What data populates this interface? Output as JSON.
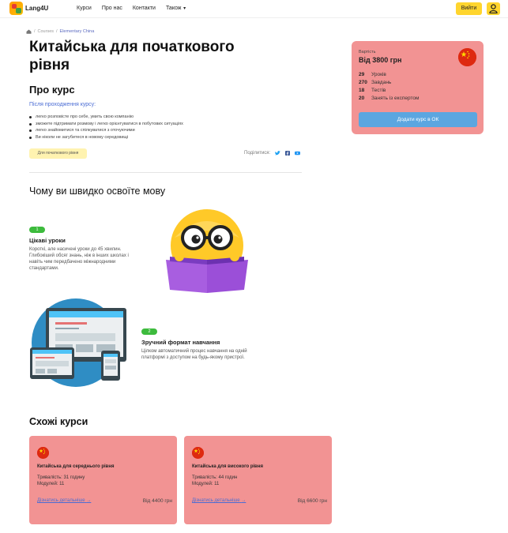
{
  "header": {
    "logo_text": "Lang4U",
    "nav": [
      "Курси",
      "Про нас",
      "Контакти",
      "Також"
    ],
    "login_label": "Вийти"
  },
  "breadcrumb": [
    "Courses",
    "Elementary China"
  ],
  "page": {
    "title": "Китайська для початкового рівня",
    "about_title": "Про курс",
    "after_label": "Після проходження курсу:",
    "benefits": [
      "легко розповісте про себе, умить свою компанію",
      "зможете підтримати розмову і легко орієнтуватися в побутових ситуаціях",
      "легко знайомитися та спілкуватися з оточуючими",
      "Ви ніколи не загубитеся в новому середовищі"
    ],
    "level_badge": "Для початкового рівня",
    "share_label": "Поділитися:"
  },
  "price_card": {
    "label": "Вартість",
    "value": "Від 3800 грн",
    "stats": [
      {
        "num": "29",
        "text": "Уроків"
      },
      {
        "num": "270",
        "text": "Завдань"
      },
      {
        "num": "18",
        "text": "Тестів"
      },
      {
        "num": "20",
        "text": "Занять із експертом"
      }
    ],
    "add_button": "Додати курс в ОК"
  },
  "why": {
    "title": "Чому ви швидко освоїте мову",
    "features": [
      {
        "num": "1",
        "title": "Цікаві уроки",
        "desc": "Короткі, але насичені уроки до 45 хвилин. Глибокіший обсяг знань, ніж в інших школах і навіть чим передбачено міжнародними стандартами."
      },
      {
        "num": "2",
        "title": "Зручний формат навчання",
        "desc": "Цілком автоматичний процес навчання на одній платформі з доступом на будь-якому пристрої."
      }
    ]
  },
  "similar": {
    "title": "Схожі курси",
    "courses": [
      {
        "title": "Китайська для середнього рівня",
        "duration": "Тривалість: 31 годину",
        "modules": "Модулей: 11",
        "link": "Дізнатись детальніше",
        "price": "Від 4400 грн"
      },
      {
        "title": "Китайська для високого рівня",
        "duration": "Тривалість: 44 годин",
        "modules": "Модулей: 11",
        "link": "Дізнатись детальніше",
        "price": "Від 6600 грн"
      }
    ]
  },
  "colors": {
    "accent": "#ffd52e",
    "card": "#f29393",
    "button": "#5ba6e0",
    "badge_green": "#3dbb3d",
    "link": "#4a6cd4"
  }
}
